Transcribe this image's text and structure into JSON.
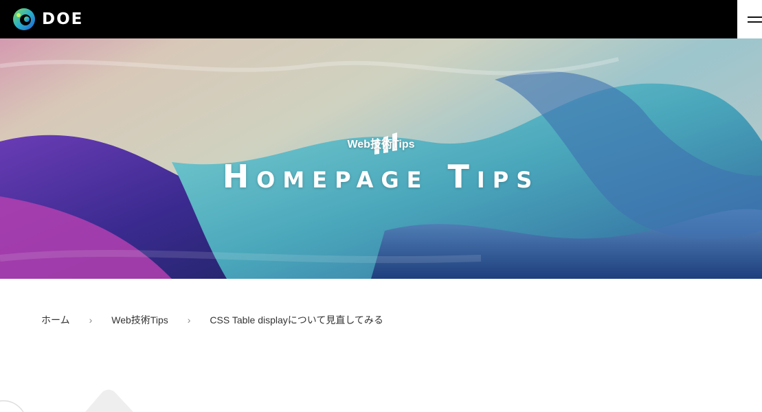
{
  "header": {
    "logo_text": "DOE",
    "logo_icon": "doe-logo-icon",
    "menu_icon": "hamburger-menu-icon"
  },
  "hero": {
    "mark_icon": "three-bars-icon",
    "subtitle": "Web技術Tips",
    "title": "Homepage Tips"
  },
  "breadcrumb": {
    "items": [
      "ホーム",
      "Web技術Tips",
      "CSS Table displayについて見直してみる"
    ],
    "separator": "›"
  },
  "colors": {
    "header_bg": "#000000",
    "text": "#333333",
    "hero_teal": "#5fb5c0",
    "hero_purple": "#5a2f9c"
  }
}
